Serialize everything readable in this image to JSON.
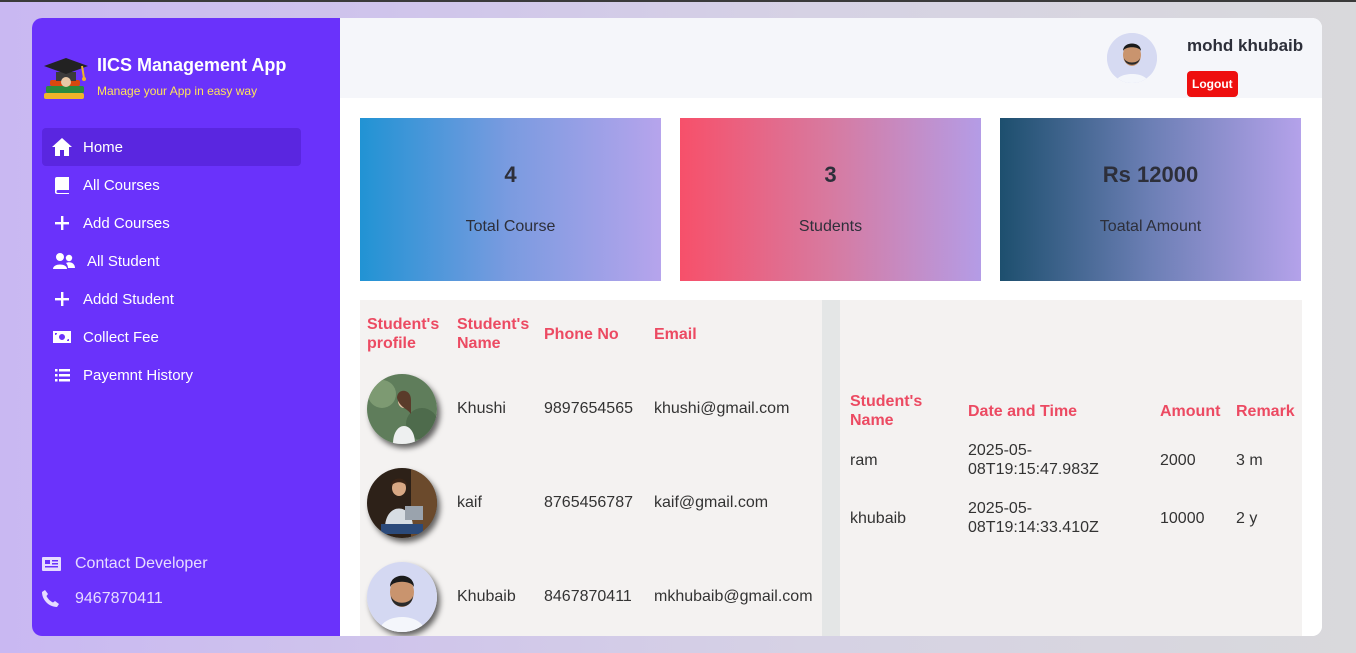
{
  "brand": {
    "title": "IICS Management App",
    "subtitle": "Manage your App in easy way"
  },
  "nav": [
    {
      "label": "Home",
      "icon": "home-icon",
      "active": true
    },
    {
      "label": "All Courses",
      "icon": "book-icon",
      "active": false
    },
    {
      "label": "Add Courses",
      "icon": "plus-icon",
      "active": false
    },
    {
      "label": "All Student",
      "icon": "users-icon",
      "active": false
    },
    {
      "label": "Addd Student",
      "icon": "plus-icon",
      "active": false
    },
    {
      "label": "Collect Fee",
      "icon": "money-icon",
      "active": false
    },
    {
      "label": "Payemnt History",
      "icon": "list-icon",
      "active": false
    }
  ],
  "contact": {
    "label": "Contact Developer",
    "phone": "9467870411"
  },
  "header": {
    "user_name": "mohd khubaib",
    "logout_label": "Logout"
  },
  "cards": [
    {
      "value": "4",
      "label": "Total Course"
    },
    {
      "value": "3",
      "label": "Students"
    },
    {
      "value": "Rs 12000",
      "label": "Toatal Amount"
    }
  ],
  "students_table": {
    "headers": [
      "Student's profile",
      "Student's Name",
      "Phone No",
      "Email"
    ],
    "rows": [
      {
        "name": "Khushi",
        "phone": "9897654565",
        "email": "khushi@gmail.com"
      },
      {
        "name": "kaif",
        "phone": "8765456787",
        "email": "kaif@gmail.com"
      },
      {
        "name": "Khubaib",
        "phone": "8467870411",
        "email": "mkhubaib@gmail.com"
      }
    ]
  },
  "payments_table": {
    "headers": [
      "Student's Name",
      "Date and Time",
      "Amount",
      "Remark"
    ],
    "rows": [
      {
        "name": "ram",
        "datetime": "2025-05-08T19:15:47.983Z",
        "amount": "2000",
        "remark": "3 m"
      },
      {
        "name": "khubaib",
        "datetime": "2025-05-08T19:14:33.410Z",
        "amount": "10000",
        "remark": "2 y"
      }
    ]
  },
  "colors": {
    "sidebar": "#6a32fb",
    "header_text": "#ec4a62",
    "logout": "#ee0f0f",
    "brand_subtitle": "#ffe35a"
  }
}
